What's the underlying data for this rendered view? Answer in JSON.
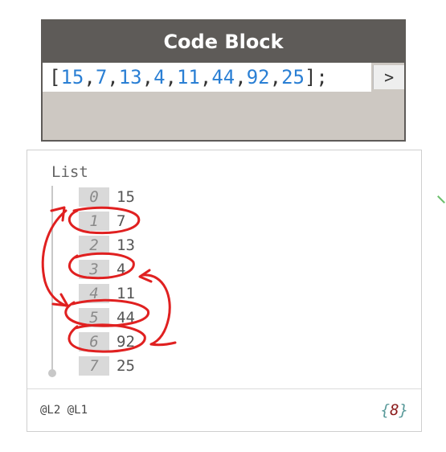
{
  "node": {
    "title": "Code Block",
    "code": {
      "open": "[",
      "items": [
        "15",
        "7",
        "13",
        "4",
        "11",
        "44",
        "92",
        "25"
      ],
      "separator": ",",
      "close": "];"
    },
    "output_port_label": ">"
  },
  "preview": {
    "list_label": "List",
    "items": [
      {
        "index": "0",
        "value": "15"
      },
      {
        "index": "1",
        "value": "7"
      },
      {
        "index": "2",
        "value": "13"
      },
      {
        "index": "3",
        "value": "4"
      },
      {
        "index": "4",
        "value": "11"
      },
      {
        "index": "5",
        "value": "44"
      },
      {
        "index": "6",
        "value": "92"
      },
      {
        "index": "7",
        "value": "25"
      }
    ],
    "levels": "@L2 @L1",
    "count_open": "{",
    "count": "8",
    "count_close": "}"
  },
  "annotations": {
    "color": "#e02020",
    "circled_indices": [
      "1",
      "3",
      "5",
      "6"
    ]
  },
  "colors": {
    "node_header": "#5e5b58",
    "node_body": "#cdc8c2",
    "number": "#2a7fd4",
    "count_value": "#8b1a1a"
  }
}
